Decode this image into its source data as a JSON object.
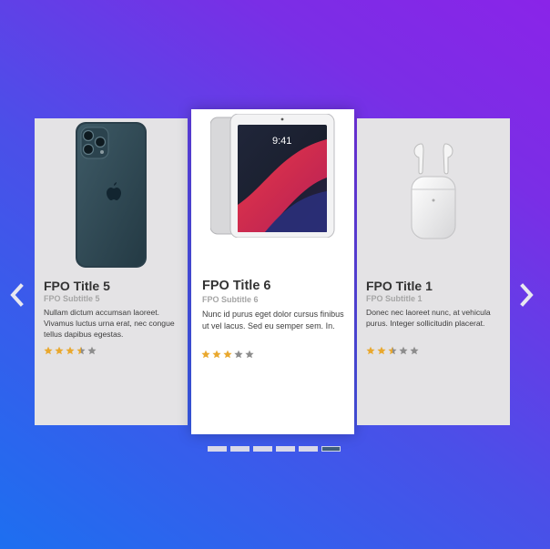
{
  "carousel": {
    "cards": [
      {
        "title": "FPO Title 5",
        "subtitle": "FPO Subtitle 5",
        "description": "Nullam dictum accumsan laoreet. Vivamus luctus urna erat, nec congue tellus dapibus egestas.",
        "rating": 3.5,
        "max_rating": 5,
        "product_icon": "phone-icon"
      },
      {
        "title": "FPO Title 6",
        "subtitle": "FPO Subtitle 6",
        "description": "Nunc id purus eget dolor cursus finibus ut vel lacus. Sed eu semper sem. In.",
        "rating": 3,
        "max_rating": 5,
        "product_icon": "tablet-icon"
      },
      {
        "title": "FPO Title 1",
        "subtitle": "FPO Subtitle 1",
        "description": "Donec nec laoreet nunc, at vehicula purus. Integer sollicitudin placerat.",
        "rating": 2.5,
        "max_rating": 5,
        "product_icon": "earbuds-icon"
      }
    ],
    "pagination": {
      "total": 6,
      "active_index": 5
    },
    "colors": {
      "star_filled": "#e9a82e",
      "star_empty": "#8d8d8d",
      "gradient_start": "#1d6ff0",
      "gradient_end": "#8a24e8"
    }
  }
}
